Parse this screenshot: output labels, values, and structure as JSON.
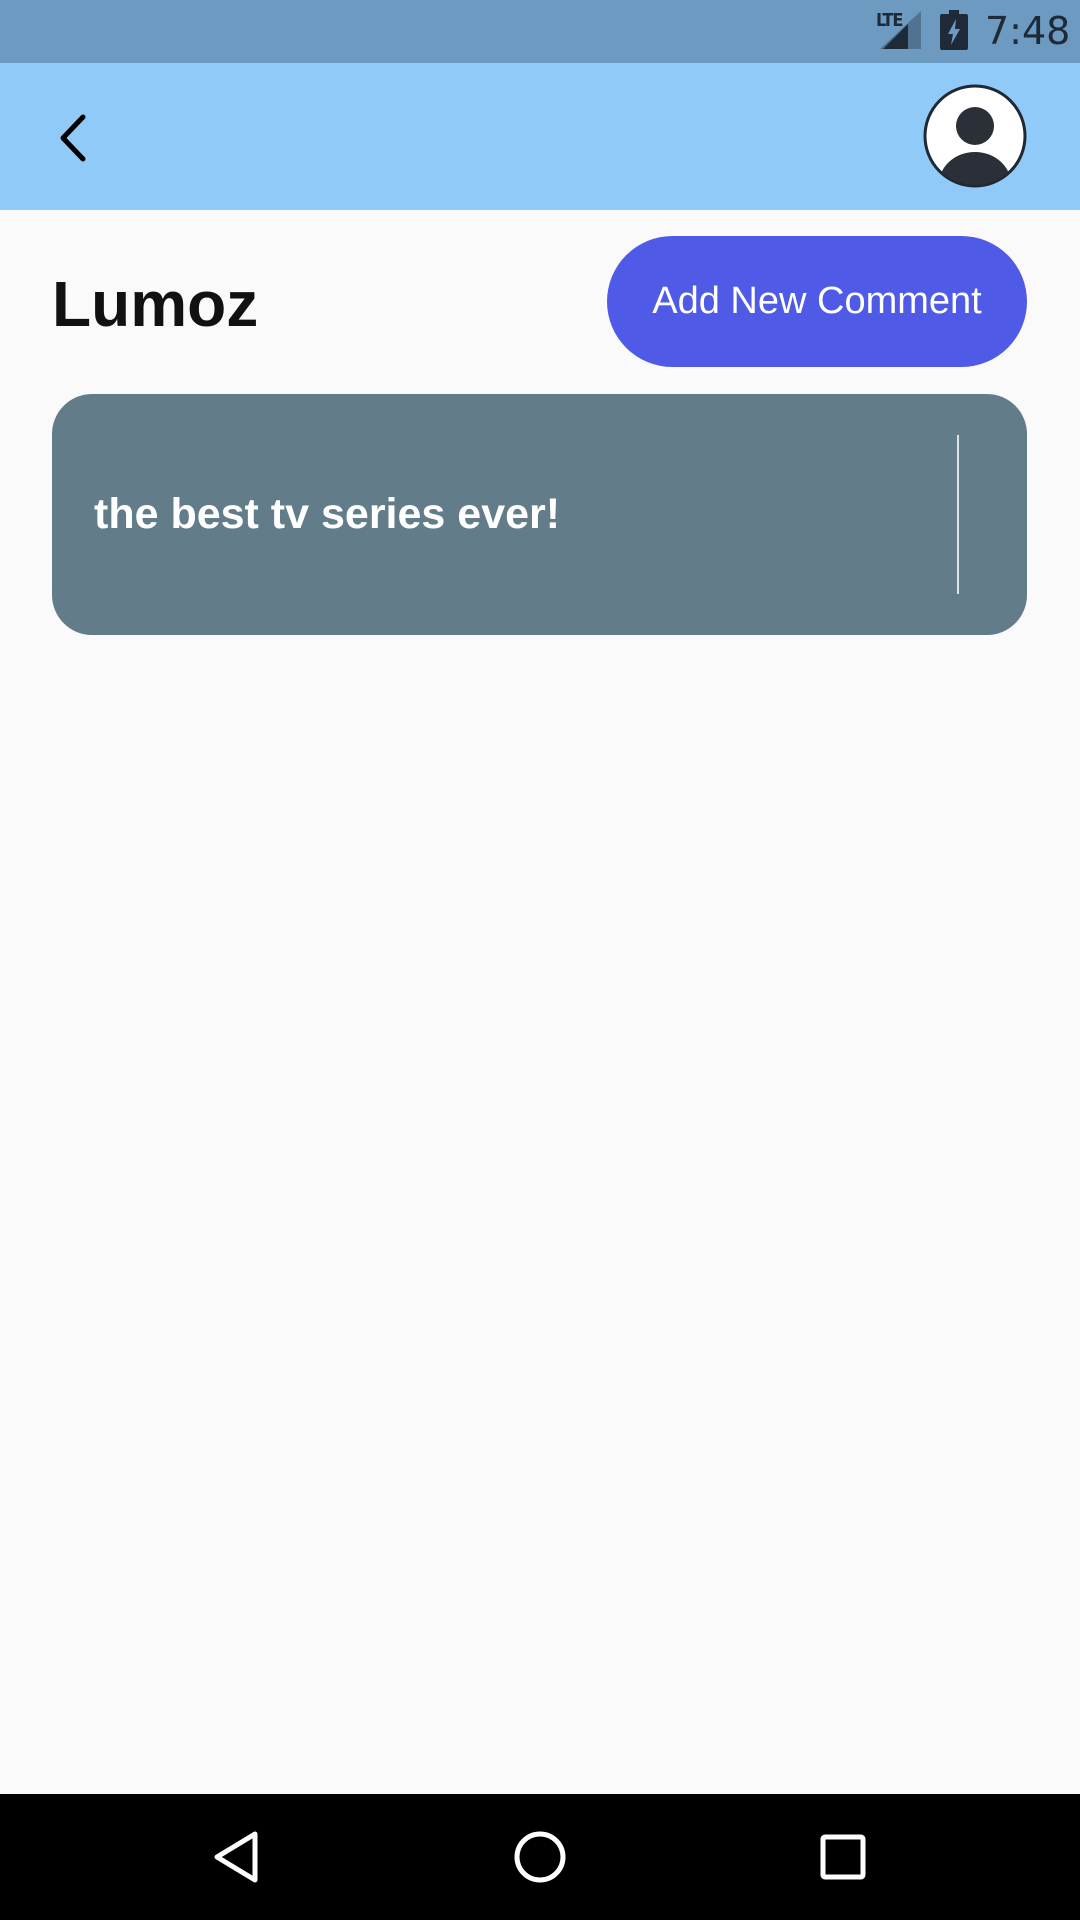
{
  "status_bar": {
    "network": "LTE",
    "time": "7:48",
    "icons": [
      "signal-icon",
      "battery-charging-icon"
    ]
  },
  "app_bar": {
    "background": "#90caf9",
    "icons": [
      "back-arrow-icon",
      "user-avatar-icon"
    ]
  },
  "header": {
    "title": "Lumoz",
    "add_comment_label": "Add New Comment",
    "accent": "#4f5be7"
  },
  "comments": [
    {
      "text": "the best tv series ever!"
    }
  ],
  "colors": {
    "status_bar": "#6d9ac0",
    "card": "#627c8a",
    "background": "#fafafa"
  },
  "nav_bar": {
    "icons": [
      "nav-back-icon",
      "nav-home-icon",
      "nav-recents-icon"
    ]
  }
}
